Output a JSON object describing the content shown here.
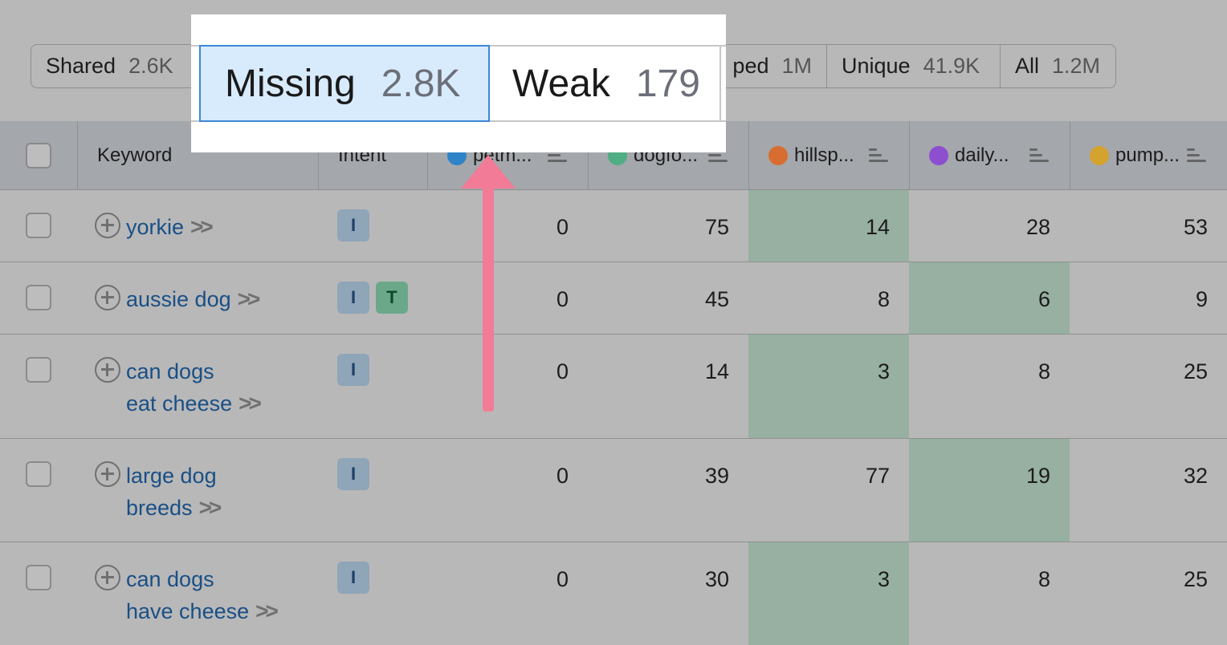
{
  "filter_tabs": {
    "shared": {
      "label": "Shared",
      "count": "2.6K"
    },
    "top": {
      "label": "ped",
      "count": "1M"
    },
    "unique": {
      "label": "Unique",
      "count": "41.9K"
    },
    "all": {
      "label": "All",
      "count": "1.2M"
    }
  },
  "callout": {
    "missing": {
      "label": "Missing",
      "count": "2.8K"
    },
    "weak": {
      "label": "Weak",
      "count": "179"
    }
  },
  "table": {
    "headers": {
      "keyword": "Keyword",
      "intent": "Intent",
      "domains": [
        {
          "label": "petm...",
          "color": "#2f83c7"
        },
        {
          "label": "dogfo...",
          "color": "#4fae83"
        },
        {
          "label": "hillsp...",
          "color": "#d86d32"
        },
        {
          "label": "daily...",
          "color": "#8d4fd0"
        },
        {
          "label": "pump...",
          "color": "#d4a22f"
        }
      ]
    },
    "rows": [
      {
        "keyword": "yorkie",
        "intents": [
          "I"
        ],
        "values": [
          "0",
          "75",
          "14",
          "28",
          "53"
        ]
      },
      {
        "keyword": "aussie dog",
        "intents": [
          "I",
          "T"
        ],
        "values": [
          "0",
          "45",
          "8",
          "6",
          "9"
        ]
      },
      {
        "keyword": "can dogs eat cheese",
        "keyword_line1": "can dogs",
        "keyword_line2": "eat cheese",
        "intents": [
          "I"
        ],
        "values": [
          "0",
          "14",
          "3",
          "8",
          "25"
        ]
      },
      {
        "keyword": "large dog breeds",
        "keyword_line1": "large dog",
        "keyword_line2": "breeds",
        "intents": [
          "I"
        ],
        "values": [
          "0",
          "39",
          "77",
          "19",
          "32"
        ]
      },
      {
        "keyword": "can dogs have cheese",
        "keyword_line1": "can dogs",
        "keyword_line2": "have cheese",
        "intents": [
          "I"
        ],
        "values": [
          "0",
          "30",
          "3",
          "8",
          "25"
        ]
      }
    ]
  },
  "colors": {
    "highlight": "#97b0a1",
    "link": "#1a4f86",
    "arrow": "#f27b97",
    "selected_tab_bg": "#d8ebfd",
    "selected_tab_border": "#3b87d6"
  },
  "icons": {
    "row_action": "plus-circle-icon",
    "row_more": "chevron-double-right-icon",
    "column_sort": "sort-icon",
    "pointer": "arrow-up-icon"
  }
}
